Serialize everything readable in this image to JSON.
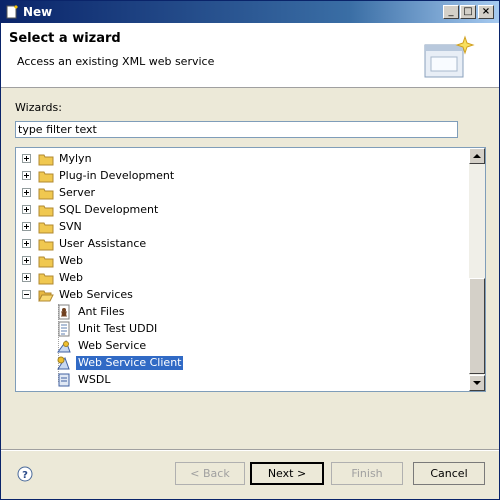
{
  "window": {
    "title": "New",
    "controls": {
      "minimize": "_",
      "maximize": "□",
      "close": "×"
    }
  },
  "header": {
    "title": "Select a wizard",
    "description": "Access an existing XML web service"
  },
  "wizards_label": "Wizards:",
  "filter": {
    "value": "type filter text"
  },
  "tree": {
    "items": [
      {
        "label": "Mylyn",
        "expanded": false,
        "icon": "folder-icon"
      },
      {
        "label": "Plug-in Development",
        "expanded": false,
        "icon": "folder-icon"
      },
      {
        "label": "Server",
        "expanded": false,
        "icon": "folder-icon"
      },
      {
        "label": "SQL Development",
        "expanded": false,
        "icon": "folder-icon"
      },
      {
        "label": "SVN",
        "expanded": false,
        "icon": "folder-icon"
      },
      {
        "label": "User Assistance",
        "expanded": false,
        "icon": "folder-icon"
      },
      {
        "label": "Web",
        "expanded": false,
        "icon": "folder-icon"
      },
      {
        "label": "Web",
        "expanded": false,
        "icon": "folder-icon"
      },
      {
        "label": "Web Services",
        "expanded": true,
        "icon": "folder-icon"
      }
    ],
    "children": [
      {
        "label": "Ant Files",
        "icon": "ant-files-icon"
      },
      {
        "label": "Unit Test UDDI",
        "icon": "uddi-icon"
      },
      {
        "label": "Web Service",
        "icon": "web-service-icon"
      },
      {
        "label": "Web Service Client",
        "icon": "web-service-client-icon",
        "selected": true
      },
      {
        "label": "WSDL",
        "icon": "wsdl-icon"
      }
    ]
  },
  "buttons": {
    "back": "< Back",
    "next": "Next >",
    "finish": "Finish",
    "cancel": "Cancel"
  },
  "colors": {
    "title_bar": "#0a246a",
    "selection": "#316ac5",
    "folder": "#f0c850"
  }
}
